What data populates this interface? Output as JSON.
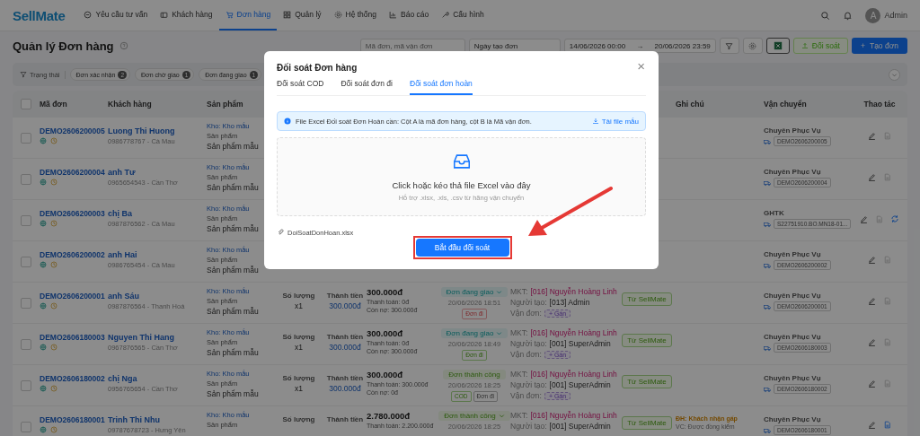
{
  "header": {
    "logo": "SellMate",
    "nav": [
      {
        "label": "Yêu cầu tư vấn",
        "selected": false
      },
      {
        "label": "Khách hàng",
        "selected": false
      },
      {
        "label": "Đơn hàng",
        "selected": true
      },
      {
        "label": "Quản lý",
        "selected": false
      },
      {
        "label": "Hệ thống",
        "selected": false
      },
      {
        "label": "Báo cáo",
        "selected": false
      },
      {
        "label": "Cấu hình",
        "selected": false
      }
    ],
    "avatar": "A",
    "user": "Admin"
  },
  "toolbar": {
    "title": "Quản lý Đơn hàng",
    "search": {
      "placeholder": "Mã đơn, mã vận đơn"
    },
    "date_type": "Ngày tạo đơn",
    "date_from": "14/06/2026 00:00",
    "date_arrow": "→",
    "date_to": "20/06/2026 23:59",
    "reconcile": "Đối soát",
    "create": "Tạo đơn",
    "create_icon": "+"
  },
  "filters": {
    "label": "Trạng thái",
    "chips": [
      {
        "label": "Đơn xác nhận",
        "count": "2"
      },
      {
        "label": "Đơn chờ giao",
        "count": "1"
      },
      {
        "label": "Đơn đang giao",
        "count": "1"
      }
    ]
  },
  "table": {
    "select_all": {
      "checked": false
    },
    "columns": [
      {
        "label": "Mã đơn"
      },
      {
        "label": "Khách hàng"
      },
      {
        "label": "Sản phẩm"
      },
      {
        "label": "Ghi chú"
      },
      {
        "label": "Vận chuyển"
      },
      {
        "label": "Thao tác"
      }
    ],
    "rows": [
      {
        "checked": false,
        "code": "DEMO2606200005",
        "customer": "Luong Thi Huong",
        "phone": "0986778767 - Cà Mau",
        "warehouse": "Kho: Kho mẫu",
        "product_label": "Sản phẩm",
        "product": "Sản phẩm mẫu",
        "carrier": "Chuyên Phục Vụ",
        "tracking": "DEMO2606200005",
        "actions": [
          {
            "kind": "edit"
          },
          {
            "kind": "file",
            "active": false
          }
        ]
      },
      {
        "checked": false,
        "code": "DEMO2606200004",
        "customer": "anh Tư",
        "phone": "0965654543 - Cần Thơ",
        "warehouse": "Kho: Kho mẫu",
        "product_label": "Sản phẩm",
        "product": "Sản phẩm mẫu",
        "carrier": "Chuyên Phục Vụ",
        "tracking": "DEMO2606200004",
        "actions": [
          {
            "kind": "edit"
          },
          {
            "kind": "file",
            "active": false
          }
        ]
      },
      {
        "checked": false,
        "code": "DEMO2606200003",
        "customer": "chị Ba",
        "phone": "0987876562 - Cà Mau",
        "warehouse": "Kho: Kho mẫu",
        "product_label": "Sản phẩm",
        "product": "Sản phẩm mẫu",
        "carrier": "GHTK",
        "tracking": "S22751910.BO.MN18-01...",
        "actions": [
          {
            "kind": "edit"
          },
          {
            "kind": "file",
            "active": false
          },
          {
            "kind": "sync"
          }
        ]
      },
      {
        "checked": false,
        "code": "DEMO2606200002",
        "customer": "anh Hai",
        "phone": "0986765454 - Cà Mau",
        "warehouse": "Kho: Kho mẫu",
        "product_label": "Sản phẩm",
        "product": "Sản phẩm mẫu",
        "carrier": "Chuyên Phục Vụ",
        "tracking": "DEMO2606200002",
        "actions": [
          {
            "kind": "edit"
          },
          {
            "kind": "file",
            "active": false
          }
        ]
      },
      {
        "checked": false,
        "code": "DEMO2606200001",
        "customer": "anh Sáu",
        "phone": "0987876564 - Thanh Hoá",
        "warehouse": "Kho: Kho mẫu",
        "product_label": "Sản phẩm",
        "product": "Sản phẩm mẫu",
        "qty_label": "Số lượng",
        "qty": "x1",
        "total_label": "Thành tiền",
        "total": "300.000đ",
        "amount": "300.000đ",
        "paid": "Thanh toán: 0đ",
        "debt": "Còn nợ: 300.000đ",
        "status": {
          "label": "Đơn đang giao",
          "kind": "shipping",
          "dropdown": true
        },
        "time": "20/06/2026 18:51",
        "badges": [
          {
            "label": "Đơn đi",
            "kind": "failed"
          }
        ],
        "mkt_label": "MKT:",
        "mkt": "[016] Nguyễn Hoàng Linh",
        "creator_label": "Người tạo:",
        "creator": "[013] Admin",
        "waybill_label": "Vận đơn:",
        "assign": "+ Gán",
        "source": "Từ SellMate",
        "carrier": "Chuyên Phục Vụ",
        "tracking": "DEMO2606200001",
        "actions": [
          {
            "kind": "edit"
          },
          {
            "kind": "file",
            "active": false
          }
        ]
      },
      {
        "checked": false,
        "code": "DEMO2606180003",
        "customer": "Nguyen Thi Hang",
        "phone": "0967876565 - Cần Thơ",
        "warehouse": "Kho: Kho mẫu",
        "product_label": "Sản phẩm",
        "product": "Sản phẩm mẫu",
        "qty_label": "Số lượng",
        "qty": "x1",
        "total_label": "Thành tiền",
        "total": "300.000đ",
        "amount": "300.000đ",
        "paid": "Thanh toán: 0đ",
        "debt": "Còn nợ: 300.000đ",
        "status": {
          "label": "Đơn đang giao",
          "kind": "shipping",
          "dropdown": true
        },
        "time": "20/06/2026 18:49",
        "badges": [
          {
            "label": "Đơn đi",
            "kind": "done"
          }
        ],
        "mkt_label": "MKT:",
        "mkt": "[016] Nguyễn Hoàng Linh",
        "creator_label": "Người tạo:",
        "creator": "[001] SuperAdmin",
        "waybill_label": "Vận đơn:",
        "assign": "+ Gán",
        "source": "Từ SellMate",
        "carrier": "Chuyên Phục Vụ",
        "tracking": "DEMO2606180003",
        "actions": [
          {
            "kind": "edit"
          },
          {
            "kind": "file",
            "active": false
          }
        ]
      },
      {
        "checked": false,
        "code": "DEMO2606180002",
        "customer": "chị Nga",
        "phone": "0956765654 - Cần Thơ",
        "warehouse": "Kho: Kho mẫu",
        "product_label": "Sản phẩm",
        "product": "Sản phẩm mẫu",
        "qty_label": "Số lượng",
        "qty": "x1",
        "total_label": "Thành tiền",
        "total": "300.000đ",
        "amount": "300.000đ",
        "paid": "Thanh toán: 300.000đ",
        "debt": "Còn nợ: 0đ",
        "status": {
          "label": "Đơn thành công",
          "kind": "success",
          "dropdown": false
        },
        "time": "20/06/2026 18:25",
        "badges": [
          {
            "label": "COD",
            "kind": "done"
          },
          {
            "label": "Đơn đi",
            "kind": "pending"
          }
        ],
        "mkt_label": "MKT:",
        "mkt": "[016] Nguyễn Hoàng Linh",
        "creator_label": "Người tạo:",
        "creator": "[001] SuperAdmin",
        "waybill_label": "Vận đơn:",
        "assign": "+ Gán",
        "source": "Từ SellMate",
        "carrier": "Chuyên Phục Vụ",
        "tracking": "DEMO2606180002",
        "actions": [
          {
            "kind": "edit"
          },
          {
            "kind": "file",
            "active": false
          }
        ]
      },
      {
        "checked": false,
        "code": "DEMO2606180001",
        "customer": "Trinh Thi Nhu",
        "phone": "09787678723 - Hưng Yên",
        "warehouse": "Kho: Kho mẫu",
        "product_label": "Sản phẩm",
        "qty_label": "Số lượng",
        "total_label": "Thành tiền",
        "amount": "2.780.000đ",
        "paid": "Thanh toán: 2.200.000đ",
        "status": {
          "label": "Đơn thành công",
          "kind": "success",
          "dropdown": true
        },
        "time": "20/06/2026 18:25",
        "mkt_label": "MKT:",
        "mkt": "[016] Nguyễn Hoàng Linh",
        "creator_label": "Người tạo:",
        "creator": "[001] SuperAdmin",
        "source": "Từ SellMate",
        "note_1": "ĐH: Khách nhận gấp",
        "note_2": "VC: Được đồng kiểm",
        "carrier": "Chuyên Phục Vụ",
        "tracking": "DEMO2606180001",
        "actions": [
          {
            "kind": "edit"
          },
          {
            "kind": "file",
            "active": true
          }
        ]
      }
    ]
  },
  "modal": {
    "title": "Đối soát Đơn hàng",
    "close": "×",
    "tabs": [
      {
        "label": "Đối soát COD",
        "selected": false
      },
      {
        "label": "Đối soát đơn đi",
        "selected": false
      },
      {
        "label": "Đối soát đơn hoàn",
        "selected": true
      }
    ],
    "info": "File Excel Đối soát Đơn Hoàn cần: Cột A là mã đơn hàng, cột B là Mã vận đơn.",
    "template_link": "Tải file mẫu",
    "drop_title": "Click hoặc kéo thả file Excel vào đây",
    "drop_hint": "Hỗ trợ .xlsx, .xls, .csv từ hãng vận chuyển",
    "file": "DoiSoatDonHoan.xlsx",
    "submit": "Bắt đầu đối soát"
  }
}
